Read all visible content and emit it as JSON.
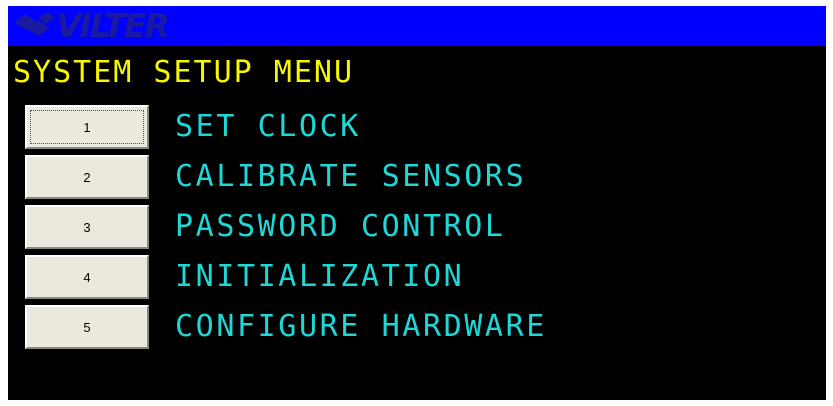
{
  "header": {
    "logo_text": "VILTER",
    "logo_icon": "vilter-logo-icon",
    "background_color": "#0000ff"
  },
  "screen": {
    "title": "SYSTEM SETUP MENU",
    "title_color": "#f7f700",
    "label_color": "#1fd7d7",
    "background_color": "#000000"
  },
  "menu": {
    "items": [
      {
        "button_label": "1",
        "label": "SET CLOCK",
        "focused": true
      },
      {
        "button_label": "2",
        "label": "CALIBRATE SENSORS"
      },
      {
        "button_label": "3",
        "label": "PASSWORD CONTROL"
      },
      {
        "button_label": "4",
        "label": "INITIALIZATION"
      },
      {
        "button_label": "5",
        "label": "CONFIGURE HARDWARE"
      }
    ]
  }
}
